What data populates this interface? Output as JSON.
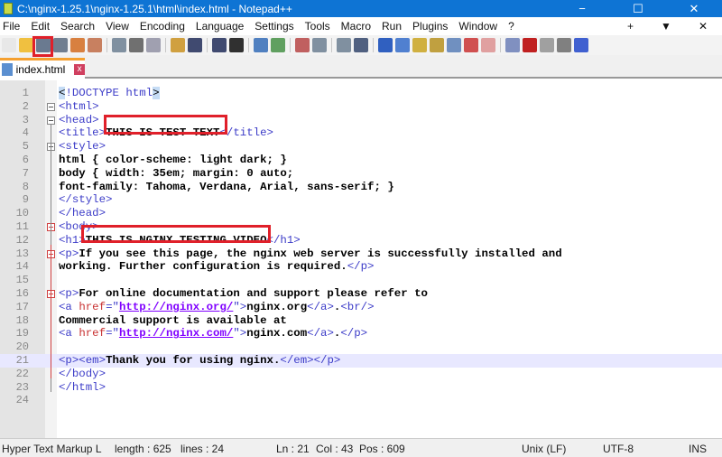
{
  "window": {
    "title": "C:\\nginx-1.25.1\\nginx-1.25.1\\html\\index.html - Notepad++",
    "minimize": "−",
    "maximize": "☐",
    "close": "✕"
  },
  "menu": [
    "File",
    "Edit",
    "Search",
    "View",
    "Encoding",
    "Language",
    "Settings",
    "Tools",
    "Macro",
    "Run",
    "Plugins",
    "Window",
    "?"
  ],
  "menu_right": [
    "+",
    "▼",
    "✕"
  ],
  "toolbar": [
    "new",
    "open",
    "save",
    "save-all",
    "close",
    "close-all",
    "print",
    "cut",
    "copy",
    "paste",
    "undo",
    "redo",
    "find",
    "replace",
    "zoom-in",
    "zoom-out",
    "sync-v",
    "sync-h",
    "word-wrap",
    "show-all",
    "indent-guide",
    "udl",
    "doc-map",
    "func-list",
    "folder-workspace",
    "monitor",
    "record",
    "stop",
    "play",
    "play-multi",
    "save-macro"
  ],
  "tab": {
    "label": "index.html",
    "close": "x"
  },
  "lines": [
    [
      [
        "h",
        "<"
      ],
      [
        "g",
        "!DOCTYPE html"
      ],
      [
        "h",
        ">"
      ]
    ],
    [
      [
        "g",
        "<html>"
      ]
    ],
    [
      [
        "g",
        "<head>"
      ]
    ],
    [
      [
        "g",
        "<title>"
      ],
      [
        "b",
        "THIS IS TEST TEXT"
      ],
      [
        "g",
        "</title>"
      ]
    ],
    [
      [
        "g",
        "<style>"
      ]
    ],
    [
      [
        "b",
        "html { color-scheme: light dark; }"
      ]
    ],
    [
      [
        "b",
        "body { width: 35em; margin: 0 auto;"
      ]
    ],
    [
      [
        "b",
        "font-family: Tahoma, Verdana, Arial, sans-serif; }"
      ]
    ],
    [
      [
        "g",
        "</style>"
      ]
    ],
    [
      [
        "g",
        "</head>"
      ]
    ],
    [
      [
        "g",
        "<body>"
      ]
    ],
    [
      [
        "g",
        "<h1>"
      ],
      [
        "b",
        "THIS IS NGINX TESTING VIDEO"
      ],
      [
        "g",
        "</h1>"
      ]
    ],
    [
      [
        "g",
        "<p>"
      ],
      [
        "b",
        "If you see this page, the nginx web server is successfully installed and"
      ]
    ],
    [
      [
        "b",
        "working. Further configuration is required."
      ],
      [
        "g",
        "</p>"
      ]
    ],
    [],
    [
      [
        "g",
        "<p>"
      ],
      [
        "b",
        "For online documentation and support please refer to"
      ]
    ],
    [
      [
        "g",
        "<a "
      ],
      [
        "a",
        "href"
      ],
      [
        "g",
        "=\""
      ],
      [
        "v",
        "http://nginx.org/"
      ],
      [
        "g",
        "\">"
      ],
      [
        "b",
        "nginx.org"
      ],
      [
        "g",
        "</a>"
      ],
      [
        "b",
        "."
      ],
      [
        "g",
        "<br/>"
      ]
    ],
    [
      [
        "b",
        "Commercial support is available at"
      ]
    ],
    [
      [
        "g",
        "<a "
      ],
      [
        "a",
        "href"
      ],
      [
        "g",
        "=\""
      ],
      [
        "v",
        "http://nginx.com/"
      ],
      [
        "g",
        "\">"
      ],
      [
        "b",
        "nginx.com"
      ],
      [
        "g",
        "</a>"
      ],
      [
        "b",
        "."
      ],
      [
        "g",
        "</p>"
      ]
    ],
    [],
    [
      [
        "g",
        "<p><em>"
      ],
      [
        "b",
        "Thank you for using nginx."
      ],
      [
        "g",
        "</em></p>"
      ]
    ],
    [
      [
        "g",
        "</body>"
      ]
    ],
    [
      [
        "g",
        "</html>"
      ]
    ],
    []
  ],
  "current_line": 21,
  "status": {
    "lang": "Hyper Text Markup L",
    "length": "length : 625",
    "lines": "lines : 24",
    "ln": "Ln : 21",
    "col": "Col : 43",
    "pos": "Pos : 609",
    "eol": "Unix (LF)",
    "enc": "UTF-8",
    "mode": "INS"
  }
}
